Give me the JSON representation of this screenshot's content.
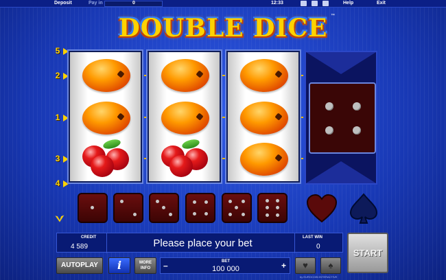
{
  "topbar": {
    "deposit": "Deposit",
    "pay_in": "Pay in",
    "pay_in_value": "0",
    "clock": "12:33",
    "help": "Help",
    "exit": "Exit"
  },
  "game": {
    "title": "DOUBLE DICE",
    "trademark": "™"
  },
  "paylines": [
    "5",
    "2",
    "1",
    "3",
    "4"
  ],
  "reels": [
    [
      "orange",
      "orange",
      "cherries"
    ],
    [
      "orange",
      "orange",
      "cherries"
    ],
    [
      "orange",
      "orange",
      "orange"
    ]
  ],
  "gamble_die_value": 4,
  "dice_row": [
    1,
    2,
    3,
    4,
    5,
    6
  ],
  "panel": {
    "credit_label": "CREDIT",
    "credit_value": "4 589",
    "message": "Please place your bet",
    "last_win_label": "LAST WIN",
    "last_win_value": "0",
    "bet_label": "BET",
    "bet_value": "100 000",
    "bet_minus": "–",
    "bet_plus": "+"
  },
  "buttons": {
    "autoplay": "AUTOPLAY",
    "info": "i",
    "more_info_1": "MORE",
    "more_info_2": "INFO",
    "start": "START"
  },
  "icons": {
    "heart": "heart-icon",
    "spade": "spade-icon"
  },
  "brand": "by EUROCOIN INTERACTIVE",
  "colors": {
    "background": "#1a3fc4",
    "gold": "#ffd200",
    "die_red": "#3a0606"
  }
}
